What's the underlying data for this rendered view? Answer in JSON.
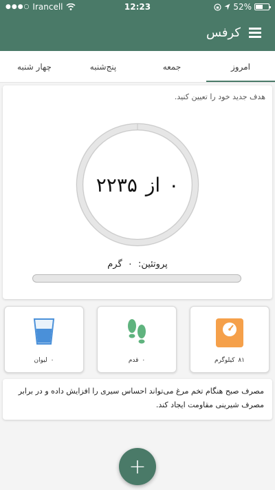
{
  "status_bar": {
    "carrier": "Irancell",
    "time": "12:23",
    "battery_percent": "52%"
  },
  "app_bar": {
    "title": "کرفس",
    "menu_icon": "hamburger-menu-icon"
  },
  "tabs": [
    {
      "label": "امروز",
      "active": true
    },
    {
      "label": "جمعه",
      "active": false
    },
    {
      "label": "پنج‌شنبه",
      "active": false
    },
    {
      "label": "چهار شنبه",
      "active": false
    }
  ],
  "goal": {
    "hint": "هدف جدید خود را تعیین کنید.",
    "consumed": "۰",
    "separator": "از",
    "target": "۲۲۳۵",
    "progress_fraction": 0
  },
  "protein": {
    "label": "پروتئین:",
    "value": "۰",
    "unit": "گرم",
    "progress_fraction": 0
  },
  "tiles": {
    "weight": {
      "value": "۸۱",
      "unit": "کیلوگرم",
      "icon": "scale-icon"
    },
    "steps": {
      "value": "۰",
      "unit": "قدم",
      "icon": "footsteps-icon"
    },
    "water": {
      "value": "۰",
      "unit": "لیوان",
      "icon": "water-glass-icon"
    }
  },
  "tip": {
    "text": "مصرف صبح هنگام تخم مرغ می‌تواند احساس سیری را افزایش داده و در برابر مصرف شیرینی مقاومت ایجاد کند."
  },
  "fab": {
    "label": "+",
    "icon": "plus-icon"
  },
  "colors": {
    "primary": "#4a7a68",
    "scale_orange": "#f5a04a",
    "steps_green": "#5fb37e",
    "water_blue": "#4a90d9"
  }
}
